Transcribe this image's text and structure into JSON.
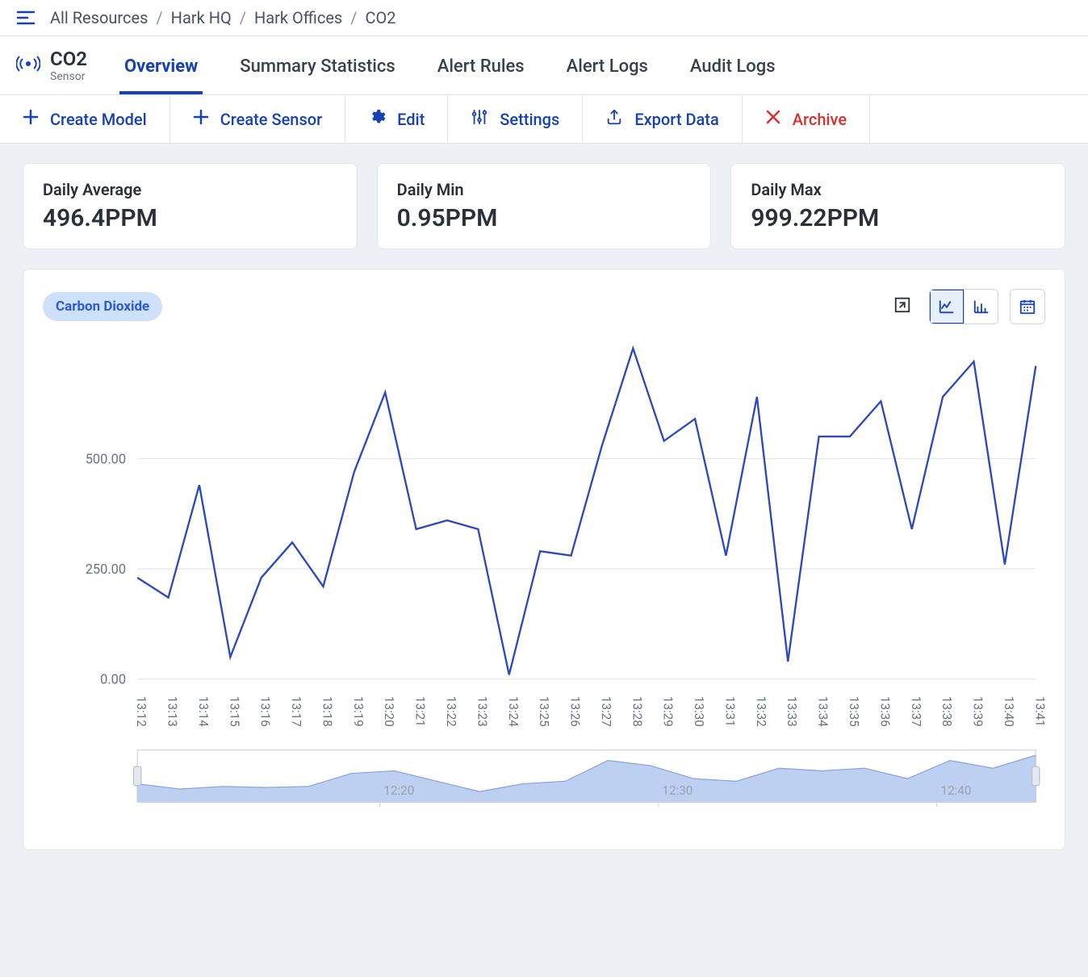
{
  "breadcrumb": [
    "All Resources",
    "Hark HQ",
    "Hark Offices",
    "CO2"
  ],
  "page": {
    "title": "CO2",
    "subtitle": "Sensor"
  },
  "tabs": [
    {
      "label": "Overview",
      "active": true
    },
    {
      "label": "Summary Statistics",
      "active": false
    },
    {
      "label": "Alert Rules",
      "active": false
    },
    {
      "label": "Alert Logs",
      "active": false
    },
    {
      "label": "Audit Logs",
      "active": false
    }
  ],
  "actions": {
    "create_model": "Create Model",
    "create_sensor": "Create Sensor",
    "edit": "Edit",
    "settings": "Settings",
    "export": "Export Data",
    "archive": "Archive"
  },
  "stats": {
    "avg_label": "Daily Average",
    "avg_value": "496.4PPM",
    "min_label": "Daily Min",
    "min_value": "0.95PPM",
    "max_label": "Daily Max",
    "max_value": "999.22PPM"
  },
  "chart": {
    "series_name": "Carbon Dioxide"
  },
  "nav_ticks": [
    "12:20",
    "12:30",
    "12:40"
  ],
  "chart_data": {
    "type": "line",
    "title": "",
    "xlabel": "",
    "ylabel": "",
    "ylim": [
      0,
      750
    ],
    "y_ticks": [
      0.0,
      250.0,
      500.0
    ],
    "categories": [
      "13:12",
      "13:13",
      "13:14",
      "13:15",
      "13:16",
      "13:17",
      "13:18",
      "13:19",
      "13:20",
      "13:21",
      "13:22",
      "13:23",
      "13:24",
      "13:25",
      "13:26",
      "13:27",
      "13:28",
      "13:29",
      "13:30",
      "13:31",
      "13:32",
      "13:33",
      "13:34",
      "13:35",
      "13:36",
      "13:37",
      "13:38",
      "13:39",
      "13:40",
      "13:41"
    ],
    "series": [
      {
        "name": "Carbon Dioxide",
        "values": [
          230,
          185,
          440,
          50,
          230,
          310,
          210,
          470,
          650,
          340,
          360,
          340,
          10,
          290,
          280,
          530,
          750,
          540,
          590,
          280,
          640,
          40,
          550,
          550,
          630,
          340,
          640,
          720,
          260,
          710
        ]
      }
    ],
    "navigator": {
      "ticks": [
        "12:20",
        "12:30",
        "12:40"
      ],
      "values": [
        0.35,
        0.25,
        0.3,
        0.28,
        0.3,
        0.55,
        0.6,
        0.4,
        0.2,
        0.35,
        0.4,
        0.8,
        0.7,
        0.45,
        0.4,
        0.65,
        0.6,
        0.65,
        0.45,
        0.8,
        0.65,
        0.9
      ]
    }
  }
}
